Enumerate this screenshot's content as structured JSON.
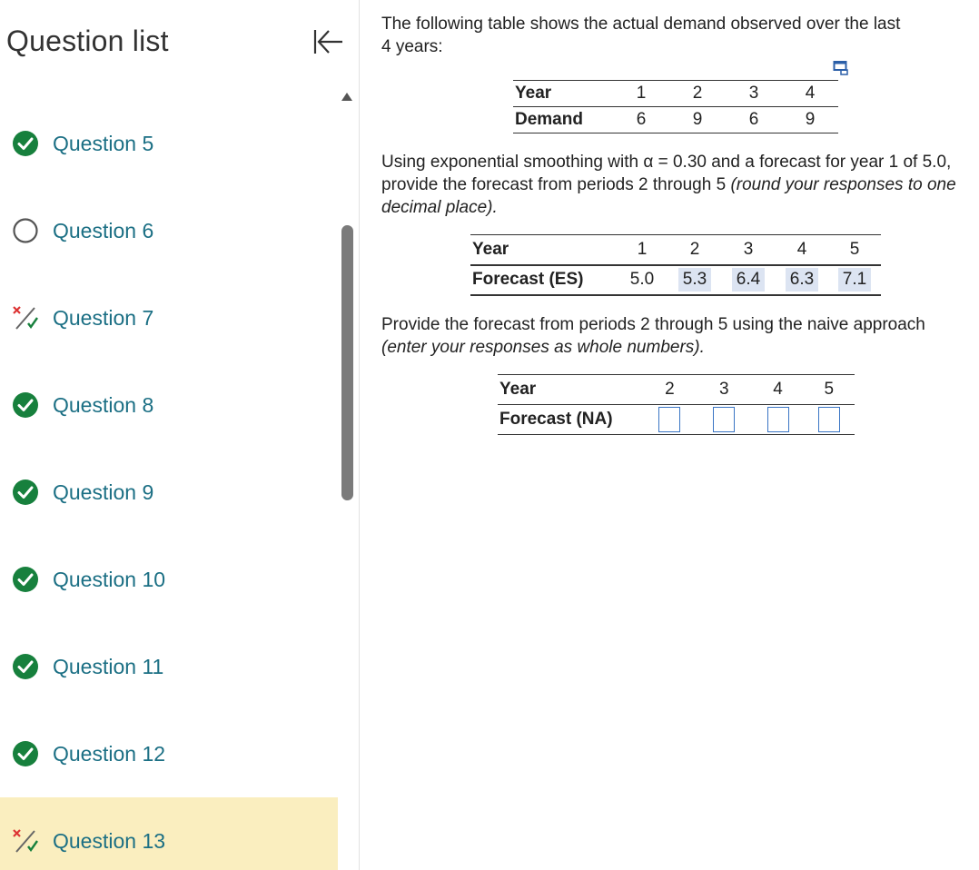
{
  "sidebar": {
    "title": "Question list",
    "collapse_icon": "collapse-left-icon",
    "items": [
      {
        "label": "Question 5",
        "status": "complete"
      },
      {
        "label": "Question 6",
        "status": "unanswered"
      },
      {
        "label": "Question 7",
        "status": "partial"
      },
      {
        "label": "Question 8",
        "status": "complete"
      },
      {
        "label": "Question 9",
        "status": "complete"
      },
      {
        "label": "Question 10",
        "status": "complete"
      },
      {
        "label": "Question 11",
        "status": "complete"
      },
      {
        "label": "Question 12",
        "status": "complete"
      },
      {
        "label": "Question 13",
        "status": "partial",
        "active": true
      }
    ]
  },
  "colors": {
    "accent_text": "#1b6f84",
    "complete_green": "#17803d",
    "active_bg": "#faeebf",
    "answer_bg": "#dce4f2",
    "input_border": "#3a75c4"
  },
  "question": {
    "intro_line1": "The following table shows the actual demand observed over the last",
    "intro_line2": "4 years:",
    "demand_table": {
      "row1_header": "Year",
      "row2_header": "Demand",
      "years": [
        "1",
        "2",
        "3",
        "4"
      ],
      "demand": [
        "6",
        "9",
        "6",
        "9"
      ]
    },
    "para2_part1": "Using exponential smoothing with",
    "para2_alpha": "α",
    "para2_part2": "= 0.30 and a forecast for year 1 of 5.0,",
    "para2_line2a": "provide the forecast from periods 2 through 5",
    "para2_line2b": "(round your responses to one",
    "para2_line3": "decimal place).",
    "es_table": {
      "row1_header": "Year",
      "row2_header": "Forecast (ES)",
      "years": [
        "1",
        "2",
        "3",
        "4",
        "5"
      ],
      "forecast_given": "5.0",
      "answers": [
        "5.3",
        "6.4",
        "6.3",
        "7.1"
      ]
    },
    "para3_line1": "Provide the forecast from periods 2 through 5 using the naive approach",
    "para3_line2": "(enter your responses as whole numbers).",
    "na_table": {
      "row1_header": "Year",
      "row2_header": "Forecast (NA)",
      "years": [
        "2",
        "3",
        "4",
        "5"
      ],
      "inputs": [
        "",
        "",
        "",
        ""
      ]
    }
  }
}
